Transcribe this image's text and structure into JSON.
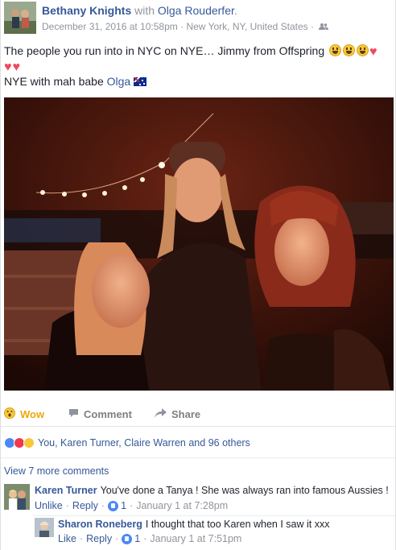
{
  "post": {
    "author": "Bethany Knights",
    "with_word": "with",
    "tagged": "Olga Rouderfer",
    "timestamp": "December 31, 2016 at 10:58pm",
    "location": "New York, NY, United States",
    "audience_icon": "friends-icon",
    "caption_line1": "The people you run into in NYC on NYE… Jimmy from Offspring",
    "caption_line2_prefix": "NYE with mah babe",
    "caption_line2_link": "Olga",
    "caption_emoji": [
      "grinning-face-icon",
      "grinning-face-icon",
      "grinning-face-icon",
      "heart-icon",
      "heart-icon",
      "heart-icon"
    ],
    "flag_icon": "australia-flag-icon",
    "photo_icon": "photo-nye-rooftop"
  },
  "actions": {
    "wow_label": "Wow",
    "comment_label": "Comment",
    "share_label": "Share"
  },
  "reactions": {
    "icons": [
      "like-reaction-icon",
      "love-reaction-icon",
      "wow-reaction-icon"
    ],
    "summary": "You, Karen Turner, Claire Warren and 96 others"
  },
  "comments": {
    "view_more": "View 7 more comments",
    "items": [
      {
        "name": "Karen Turner",
        "text": "You've done a Tanya ! She was always ran into famous Aussies !",
        "action1": "Unlike",
        "action2": "Reply",
        "likes": "1",
        "time": "January 1 at 7:28pm"
      },
      {
        "name": "Sharon Roneberg",
        "text": "I thought that too Karen when I saw it xxx",
        "action1": "Like",
        "action2": "Reply",
        "likes": "1",
        "time": "January 1 at 7:51pm"
      }
    ]
  },
  "colors": {
    "link": "#365899",
    "muted": "#90949c",
    "wow": "#f0a70a",
    "like_blue": "#4b88f5",
    "love_red": "#f0384f"
  }
}
